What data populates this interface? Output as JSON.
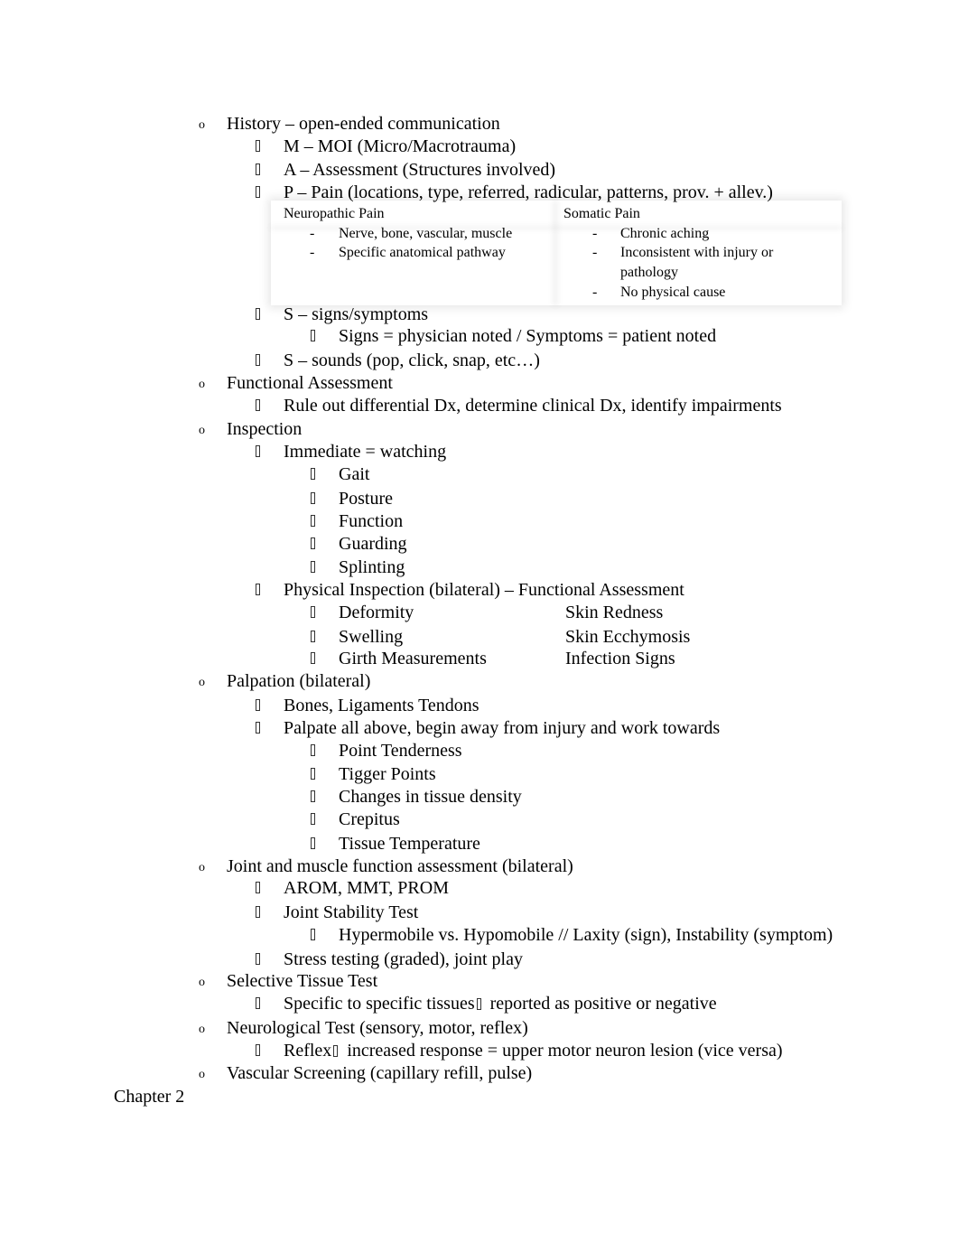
{
  "document": {
    "sections": [
      {
        "title": "History – open-ended communication",
        "items": [
          {
            "text": "M – MOI (Micro/Macrotrauma)"
          },
          {
            "text": "A – Assessment (Structures involved)"
          },
          {
            "text": "P – Pain (locations, type, referred, radicular, patterns, prov. + allev.)"
          },
          {
            "text": "S – signs/symptoms",
            "sub": [
              "Signs = physician noted / Symptoms = patient noted"
            ]
          },
          {
            "text": "S – sounds (pop, click, snap, etc…)"
          }
        ]
      },
      {
        "title": "Functional Assessment",
        "items": [
          {
            "text": "Rule out differential Dx, determine clinical Dx, identify impairments"
          }
        ]
      },
      {
        "title": "Inspection",
        "items": [
          {
            "text": "Immediate = watching",
            "sub": [
              "Gait",
              "Posture",
              "Function",
              "Guarding",
              "Splinting"
            ]
          },
          {
            "text": "Physical Inspection (bilateral) – Functional Assessment",
            "sub": [
              "Deformity",
              "Swelling",
              "Girth Measurements"
            ],
            "sub_right": [
              "Skin Redness",
              "Skin Ecchymosis",
              "Infection Signs"
            ]
          }
        ]
      },
      {
        "title": "Palpation (bilateral)",
        "items": [
          {
            "text": "Bones, Ligaments Tendons"
          },
          {
            "text": "Palpate all above, begin away from injury and work towards",
            "sub": [
              "Point Tenderness",
              "Tigger Points",
              "Changes in tissue density",
              "Crepitus",
              "Tissue Temperature"
            ]
          }
        ]
      },
      {
        "title": "Joint and muscle function assessment (bilateral)",
        "items": [
          {
            "text": "AROM, MMT, PROM"
          },
          {
            "text": "Joint Stability Test",
            "sub": [
              "Hypermobile vs. Hypomobile // Laxity (sign), Instability (symptom)"
            ]
          },
          {
            "text": "Stress testing (graded), joint play"
          }
        ]
      },
      {
        "title": "Selective Tissue Test",
        "items": [
          {
            "text_before": "Specific to specific tissues",
            "text_after": "reported as positive or negative"
          }
        ]
      },
      {
        "title": "Neurological Test (sensory, motor, reflex)",
        "items": [
          {
            "text_before": "Reflex",
            "text_after": "increased response = upper motor neuron lesion (vice versa)"
          }
        ]
      },
      {
        "title": "Vascular Screening (capillary refill, pulse)",
        "items": []
      }
    ],
    "pain_table": {
      "columns": [
        {
          "header": "Neuropathic Pain",
          "items": [
            "Nerve, bone, vascular, muscle",
            "Specific anatomical pathway"
          ]
        },
        {
          "header": "Somatic Pain",
          "items": [
            "Chronic aching",
            "Inconsistent with injury or",
            "pathology",
            "No physical cause"
          ]
        }
      ],
      "dash": "-"
    },
    "level1_bullet": "o",
    "footer_heading": "Chapter 2"
  }
}
